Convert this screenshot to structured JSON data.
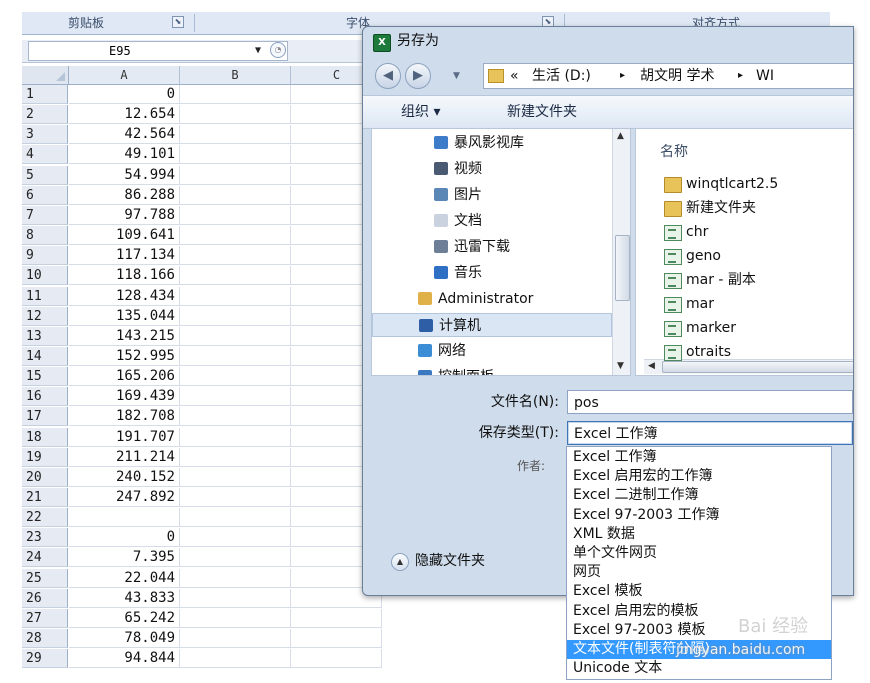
{
  "ribbon": {
    "clipboard": "剪贴板",
    "font": "字体",
    "alignment": "对齐方式"
  },
  "formula_bar": {
    "name_box": "E95"
  },
  "sheet": {
    "columns": [
      "A",
      "B",
      "C"
    ],
    "rows": [
      {
        "n": "1",
        "a": "0"
      },
      {
        "n": "2",
        "a": "12.654"
      },
      {
        "n": "3",
        "a": "42.564"
      },
      {
        "n": "4",
        "a": "49.101"
      },
      {
        "n": "5",
        "a": "54.994"
      },
      {
        "n": "6",
        "a": "86.288"
      },
      {
        "n": "7",
        "a": "97.788"
      },
      {
        "n": "8",
        "a": "109.641"
      },
      {
        "n": "9",
        "a": "117.134"
      },
      {
        "n": "10",
        "a": "118.166"
      },
      {
        "n": "11",
        "a": "128.434"
      },
      {
        "n": "12",
        "a": "135.044"
      },
      {
        "n": "13",
        "a": "143.215"
      },
      {
        "n": "14",
        "a": "152.995"
      },
      {
        "n": "15",
        "a": "165.206"
      },
      {
        "n": "16",
        "a": "169.439"
      },
      {
        "n": "17",
        "a": "182.708"
      },
      {
        "n": "18",
        "a": "191.707"
      },
      {
        "n": "19",
        "a": "211.214"
      },
      {
        "n": "20",
        "a": "240.152"
      },
      {
        "n": "21",
        "a": "247.892"
      },
      {
        "n": "22",
        "a": ""
      },
      {
        "n": "23",
        "a": "0"
      },
      {
        "n": "24",
        "a": "7.395"
      },
      {
        "n": "25",
        "a": "22.044"
      },
      {
        "n": "26",
        "a": "43.833"
      },
      {
        "n": "27",
        "a": "65.242"
      },
      {
        "n": "28",
        "a": "78.049"
      },
      {
        "n": "29",
        "a": "94.844"
      }
    ]
  },
  "dialog": {
    "title": "另存为",
    "address": {
      "prefix": "«",
      "parts": [
        "生活 (D:)",
        "▸",
        "胡文明 学术",
        "▸",
        "WI"
      ]
    },
    "toolbar": {
      "organize": "组织 ▾",
      "new_folder": "新建文件夹"
    },
    "tree": [
      {
        "label": "暴风影视库",
        "color": "#3d7cc9",
        "indent": 62
      },
      {
        "label": "视频",
        "color": "#4a5a72",
        "indent": 62
      },
      {
        "label": "图片",
        "color": "#5a87b5",
        "indent": 62
      },
      {
        "label": "文档",
        "color": "#c9d2de",
        "indent": 62
      },
      {
        "label": "迅雷下载",
        "color": "#6d7e97",
        "indent": 62
      },
      {
        "label": "音乐",
        "color": "#2f6fc4",
        "indent": 62
      },
      {
        "label": "Administrator",
        "color": "#e0b148",
        "indent": 46
      },
      {
        "label": "计算机",
        "color": "#2e5ea6",
        "indent": 46
      },
      {
        "label": "网络",
        "color": "#3b8ed6",
        "indent": 46
      },
      {
        "label": "控制面板",
        "color": "#3b78c2",
        "indent": 46
      }
    ],
    "files_header": "名称",
    "files": [
      {
        "label": "winqtlcart2.5",
        "type": "folder"
      },
      {
        "label": "新建文件夹",
        "type": "folder"
      },
      {
        "label": "chr",
        "type": "doc"
      },
      {
        "label": "geno",
        "type": "doc"
      },
      {
        "label": "mar - 副本",
        "type": "doc"
      },
      {
        "label": "mar",
        "type": "doc"
      },
      {
        "label": "marker",
        "type": "doc"
      },
      {
        "label": "otraits",
        "type": "doc"
      }
    ],
    "filename_label": "文件名(N):",
    "filename_value": "pos",
    "savetype_label": "保存类型(T):",
    "savetype_value": "Excel 工作簿",
    "author_label": "作者:",
    "hide_folders": "隐藏文件夹",
    "type_options": [
      "Excel 工作簿",
      "Excel 启用宏的工作簿",
      "Excel 二进制工作簿",
      "Excel 97-2003 工作簿",
      "XML 数据",
      "单个文件网页",
      "网页",
      "Excel 模板",
      "Excel 启用宏的模板",
      "Excel 97-2003 模板",
      "文本文件(制表符分隔)",
      "Unicode 文本"
    ],
    "selected_option_index": 10
  },
  "watermark": {
    "brand": "Bai 经验",
    "url": "jingyan.baidu.com"
  }
}
